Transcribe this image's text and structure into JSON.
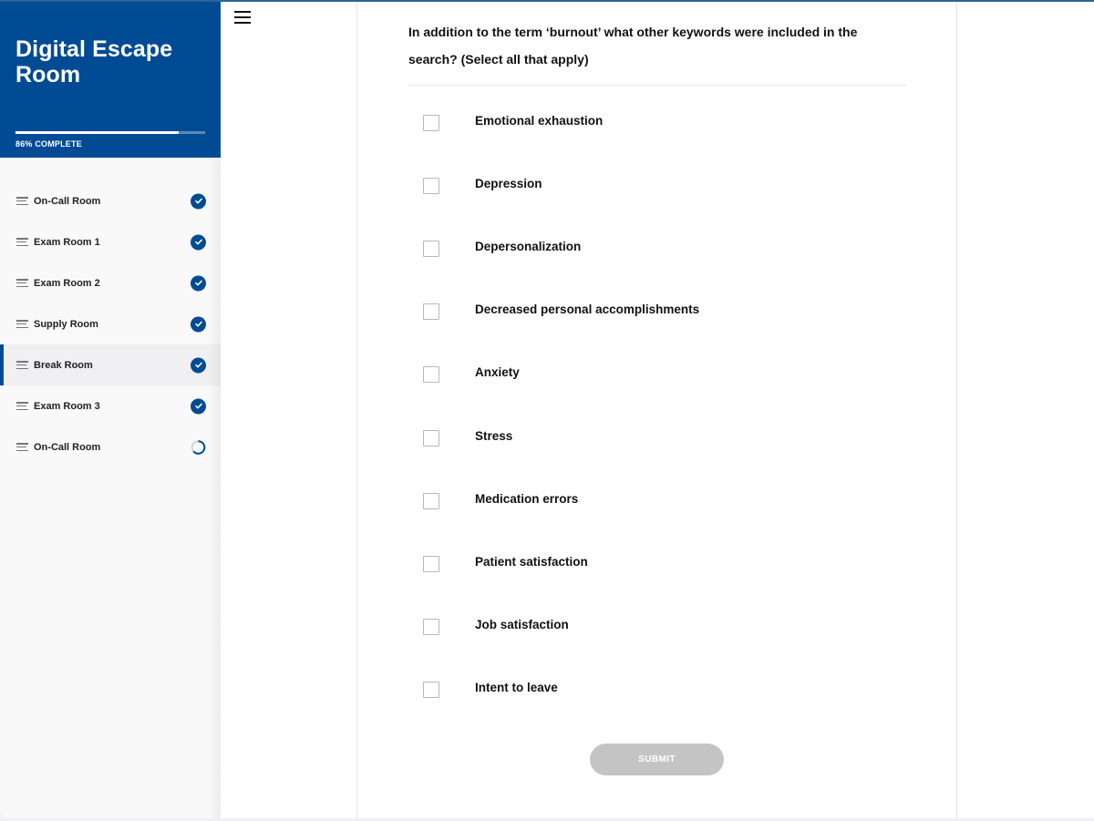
{
  "app": {
    "title": "Digital Escape Room",
    "progress_percent": 86,
    "progress_label": "86% COMPLETE",
    "accent_color": "#004b93"
  },
  "sidebar": {
    "items": [
      {
        "label": "On-Call Room",
        "status": "complete",
        "icon": "lines-icon",
        "active": false
      },
      {
        "label": "Exam Room 1",
        "status": "complete",
        "icon": "lines-icon",
        "active": false
      },
      {
        "label": "Exam Room 2",
        "status": "complete",
        "icon": "lines-icon",
        "active": false
      },
      {
        "label": "Supply Room",
        "status": "complete",
        "icon": "lines-icon",
        "active": false
      },
      {
        "label": "Break Room",
        "status": "complete",
        "icon": "lines-icon",
        "active": true
      },
      {
        "label": "Exam Room 3",
        "status": "complete",
        "icon": "lines-icon",
        "active": false
      },
      {
        "label": "On-Call Room",
        "status": "in-progress",
        "icon": "lines-icon",
        "active": false
      }
    ]
  },
  "toolbar": {
    "menu_icon": "hamburger-menu-icon"
  },
  "quiz": {
    "question": "In addition to the term ‘burnout’ what other keywords were included in the search? (Select all that apply)",
    "options": [
      {
        "label": "Emotional exhaustion",
        "checked": false
      },
      {
        "label": "Depression",
        "checked": false
      },
      {
        "label": "Depersonalization",
        "checked": false
      },
      {
        "label": "Decreased personal accomplishments",
        "checked": false
      },
      {
        "label": "Anxiety",
        "checked": false
      },
      {
        "label": "Stress",
        "checked": false
      },
      {
        "label": "Medication errors",
        "checked": false
      },
      {
        "label": "Patient satisfaction",
        "checked": false
      },
      {
        "label": "Job satisfaction",
        "checked": false
      },
      {
        "label": "Intent to leave",
        "checked": false
      }
    ],
    "submit_label": "SUBMIT",
    "submit_enabled": false
  }
}
